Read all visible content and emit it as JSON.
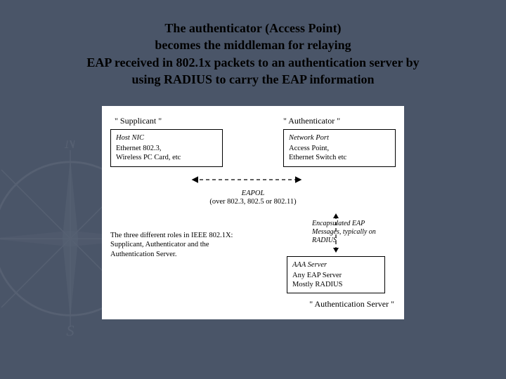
{
  "header": {
    "line1": "The authenticator (Access Point)",
    "line2": "becomes the middleman for relaying",
    "line3": "EAP received in 802.1x packets to an authentication server by",
    "line4": "using RADIUS to carry the EAP information"
  },
  "diagram": {
    "supplicant": {
      "label": "\" Supplicant \"",
      "box_title": "Host NIC",
      "box_line1": "Ethernet 802.3,",
      "box_line2": "Wireless PC Card, etc"
    },
    "authenticator": {
      "label": "\" Authenticator \"",
      "box_title": "Network Port",
      "box_line1": "Access Point,",
      "box_line2": "Ethernet Switch etc"
    },
    "eapol": {
      "title": "EAPOL",
      "sub": "(over 802.3, 802.5 or 802.11)"
    },
    "description": "The three different roles in IEEE 802.1X: Supplicant, Authenticator and the Authentication Server.",
    "encapsulated": "Encapsulated EAP Messages, typically on RADIUS",
    "aaa": {
      "title": "AAA Server",
      "line1": "Any EAP Server",
      "line2": "Mostly RADIUS"
    },
    "auth_server_label": "\" Authentication Server \""
  }
}
